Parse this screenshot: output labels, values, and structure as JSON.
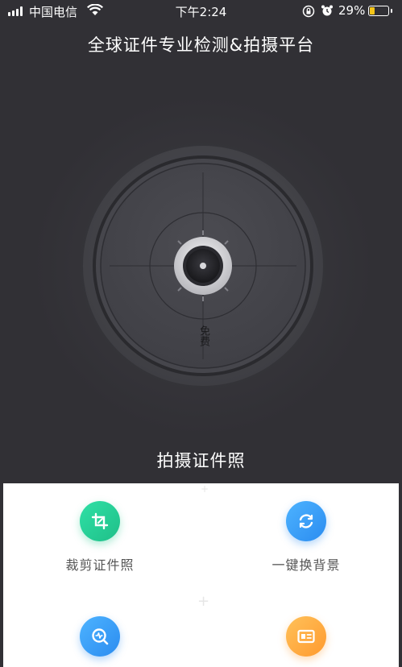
{
  "status_bar": {
    "carrier": "中国电信",
    "time": "下午2:24",
    "battery": "29%",
    "battery_level_fraction": 0.29,
    "icons": [
      "signal-icon",
      "wifi-icon",
      "rotation-lock-icon",
      "alarm-icon",
      "battery-icon"
    ]
  },
  "header": {
    "title": "全球证件专业检测&拍摄平台"
  },
  "camera": {
    "badge": "免费",
    "capture_label": "拍摄证件照"
  },
  "features": [
    {
      "label": "裁剪证件照",
      "icon": "crop-icon",
      "color": "#22c98f"
    },
    {
      "label": "一键换背景",
      "icon": "refresh-icon",
      "color": "#3a9ef5"
    },
    {
      "label": "",
      "icon": "search-check-icon",
      "color": "#3a9ef5"
    },
    {
      "label": "",
      "icon": "id-card-icon",
      "color": "#ffab3f"
    }
  ],
  "colors": {
    "background": "#313035",
    "panel": "#ffffff",
    "accent_green": "#22c98f",
    "accent_blue": "#3a9ef5",
    "accent_orange": "#ffab3f"
  }
}
